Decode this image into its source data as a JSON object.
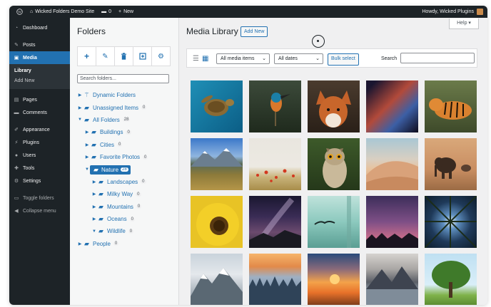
{
  "adminbar": {
    "site_name": "Wicked Folders Demo Site",
    "comments_count": "0",
    "new_label": "New",
    "howdy": "Howdy, Wicked Plugins"
  },
  "menu": {
    "dashboard": "Dashboard",
    "posts": "Posts",
    "media": "Media",
    "library": "Library",
    "add_new": "Add New",
    "pages": "Pages",
    "comments": "Comments",
    "appearance": "Appearance",
    "plugins": "Plugins",
    "users": "Users",
    "tools": "Tools",
    "settings": "Settings",
    "toggle_folders": "Toggle folders",
    "collapse_menu": "Collapse menu"
  },
  "folders": {
    "title": "Folders",
    "search_placeholder": "Search folders...",
    "tree": [
      {
        "label": "Dynamic Folders",
        "count": ""
      },
      {
        "label": "Unassigned Items",
        "count": "0"
      },
      {
        "label": "All Folders",
        "count": "28"
      },
      {
        "label": "Buildings",
        "count": "0"
      },
      {
        "label": "Cities",
        "count": "0"
      },
      {
        "label": "Favorite Photos",
        "count": "0"
      },
      {
        "label": "Nature",
        "count": "28"
      },
      {
        "label": "Landscapes",
        "count": "0"
      },
      {
        "label": "Milky Way",
        "count": "0"
      },
      {
        "label": "Mountains",
        "count": "0"
      },
      {
        "label": "Oceans",
        "count": "0"
      },
      {
        "label": "Wildlife",
        "count": "0"
      },
      {
        "label": "People",
        "count": "0"
      }
    ]
  },
  "media_library": {
    "title": "Media Library",
    "add_new": "Add New",
    "help": "Help",
    "filter_type": "All media items",
    "filter_date": "All dates",
    "bulk_select": "Bulk select",
    "search_label": "Search"
  }
}
